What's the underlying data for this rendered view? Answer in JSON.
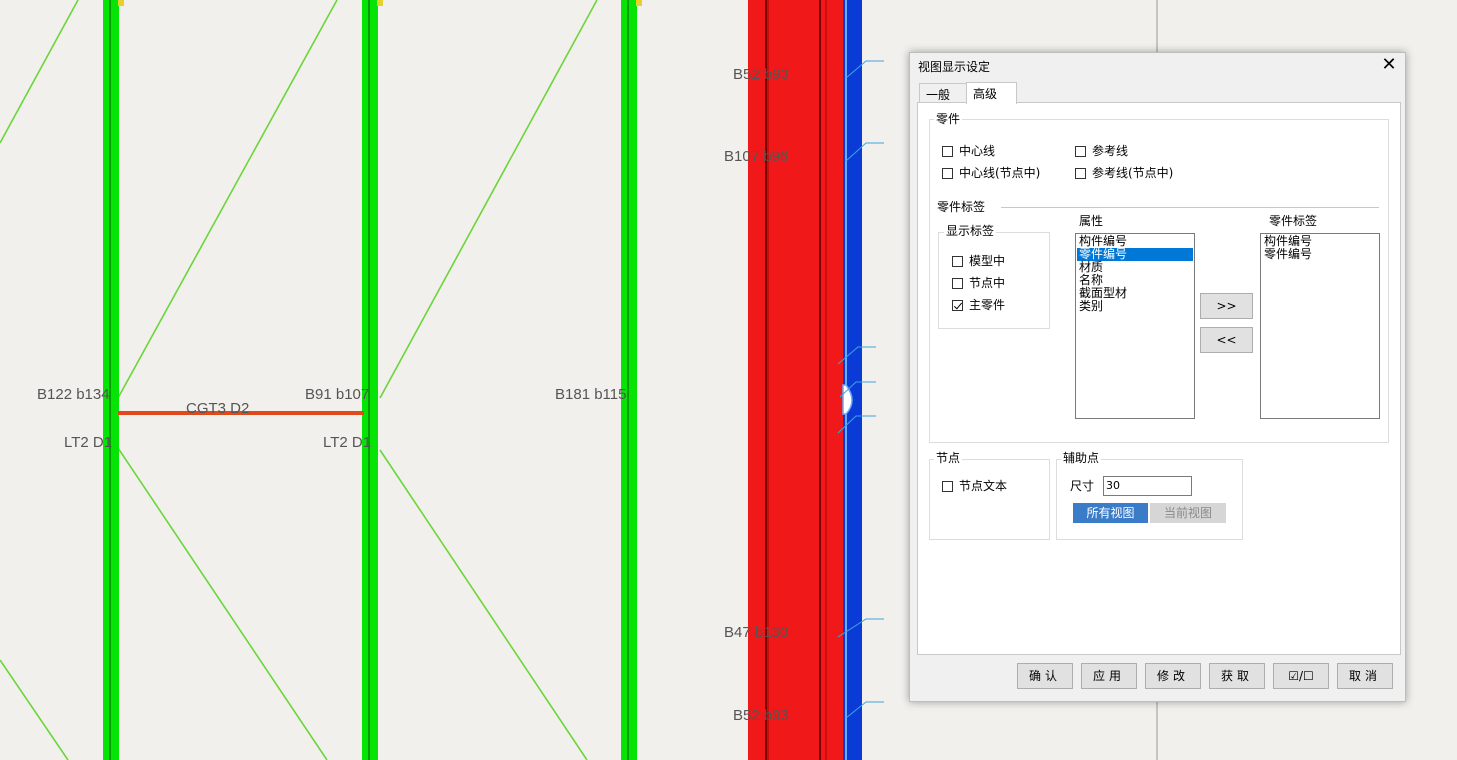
{
  "canvas_labels": {
    "b122": "B122 b134",
    "cgt": "CGT3 D2",
    "b91": "B91 b107",
    "b181": "B181 b115",
    "lt2a": "LT2 D1",
    "lt2b": "LT2 D1",
    "b52a": "B52 b93",
    "b107": "B107 b96",
    "b47": "B47 b130",
    "b52b": "B52 b93"
  },
  "dialog": {
    "title": "视图显示设定",
    "close_icon": "close-icon",
    "tabs": [
      {
        "label": "一般"
      },
      {
        "label": "高级"
      }
    ],
    "parts_group": {
      "title": "零件",
      "checkboxes": [
        {
          "label": "中心线",
          "checked": false
        },
        {
          "label": "参考线",
          "checked": false
        },
        {
          "label": "中心线(节点中)",
          "checked": false
        },
        {
          "label": "参考线(节点中)",
          "checked": false
        }
      ]
    },
    "part_label_group": {
      "title": "零件标签",
      "show_label": {
        "title": "显示标签",
        "checkboxes": [
          {
            "label": "模型中",
            "checked": false
          },
          {
            "label": "节点中",
            "checked": false
          },
          {
            "label": "主零件",
            "checked": true
          }
        ]
      },
      "attributes": {
        "header": "属性",
        "items": [
          "构件编号",
          "零件编号",
          "材质",
          "名称",
          "截面型材",
          "类别"
        ],
        "selected_index": 1
      },
      "add_button": ">>",
      "remove_button": "<<",
      "labels": {
        "header": "零件标签",
        "items": [
          "构件编号",
          "零件编号"
        ]
      }
    },
    "node_group": {
      "title": "节点",
      "checkbox": {
        "label": "节点文本",
        "checked": false
      }
    },
    "aux_group": {
      "title": "辅助点",
      "size_label": "尺寸",
      "size_value": "30",
      "all_views": "所有视图",
      "current_view": "当前视图"
    },
    "buttons": {
      "ok": "确认",
      "apply": "应用",
      "modify": "修改",
      "get": "获取",
      "toggle": "☑/☐",
      "cancel": "取消"
    }
  }
}
